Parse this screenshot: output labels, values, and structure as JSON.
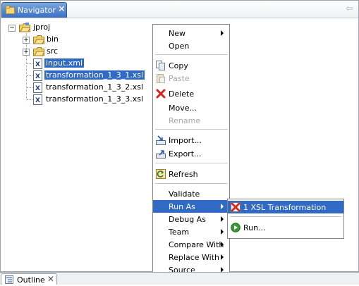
{
  "view": {
    "tab_title": "Navigator",
    "close_glyph": "✕",
    "back_glyph": "⇦"
  },
  "tree": {
    "project": "jproj",
    "items": [
      {
        "label": "bin",
        "kind": "folder"
      },
      {
        "label": "src",
        "kind": "folder"
      },
      {
        "label": "input.xml",
        "kind": "file"
      },
      {
        "label": "transformation_1_3_1.xsl",
        "kind": "file"
      },
      {
        "label": "transformation_1_3_2.xsl",
        "kind": "file"
      },
      {
        "label": "transformation_1_3_3.xsl",
        "kind": "file"
      }
    ],
    "file_icon_letter": "X"
  },
  "menu": {
    "new": "New",
    "open": "Open",
    "copy": "Copy",
    "paste": "Paste",
    "delete": "Delete",
    "move": "Move...",
    "rename": "Rename",
    "import": "Import...",
    "export": "Export...",
    "refresh": "Refresh",
    "validate": "Validate",
    "run_as": "Run As",
    "debug_as": "Debug As",
    "team": "Team",
    "compare_with": "Compare With",
    "replace_with": "Replace With",
    "source": "Source"
  },
  "submenu": {
    "xsl_transformation": "1 XSL Transformation",
    "run": "Run..."
  },
  "outline": {
    "tab_title": "Outline",
    "close_glyph": "✕"
  },
  "colors": {
    "selection": "#316ac5",
    "tab_active": "#3a6fc4"
  }
}
